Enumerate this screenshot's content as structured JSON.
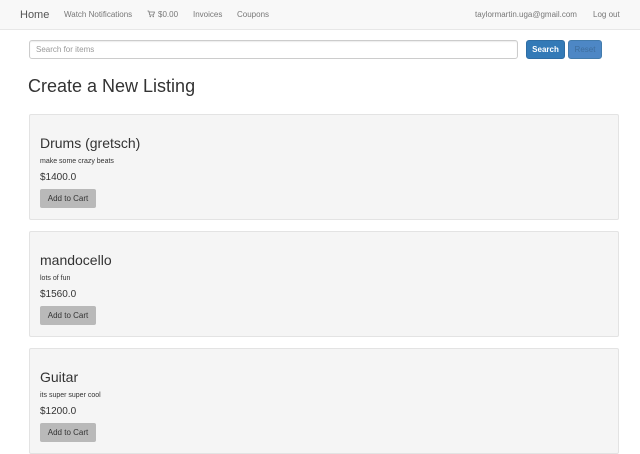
{
  "navbar": {
    "brand": "Home",
    "links": {
      "watch_notifications": "Watch Notifications",
      "cart_total": "$0.00",
      "invoices": "Invoices",
      "coupons": "Coupons"
    },
    "user_email": "taylormartin.uga@gmail.com",
    "logout": "Log out",
    "cart_icon": "shopping-cart-icon"
  },
  "search": {
    "placeholder": "Search for items",
    "value": "",
    "search_label": "Search",
    "reset_label": "Reset"
  },
  "page": {
    "title": "Create a New Listing"
  },
  "listings": [
    {
      "name": "Drums (gretsch)",
      "description": "make some crazy beats",
      "price": "$1400.0",
      "button": "Add to Cart"
    },
    {
      "name": "mandocello",
      "description": "lots of fun",
      "price": "$1560.0",
      "button": "Add to Cart"
    },
    {
      "name": "Guitar",
      "description": "its super super cool",
      "price": "$1200.0",
      "button": "Add to Cart"
    }
  ],
  "colors": {
    "primary": "#337ab7",
    "navbar_bg": "#f8f8f8",
    "card_bg": "#f5f5f5",
    "cart_button_bg": "#b9b9b9"
  }
}
